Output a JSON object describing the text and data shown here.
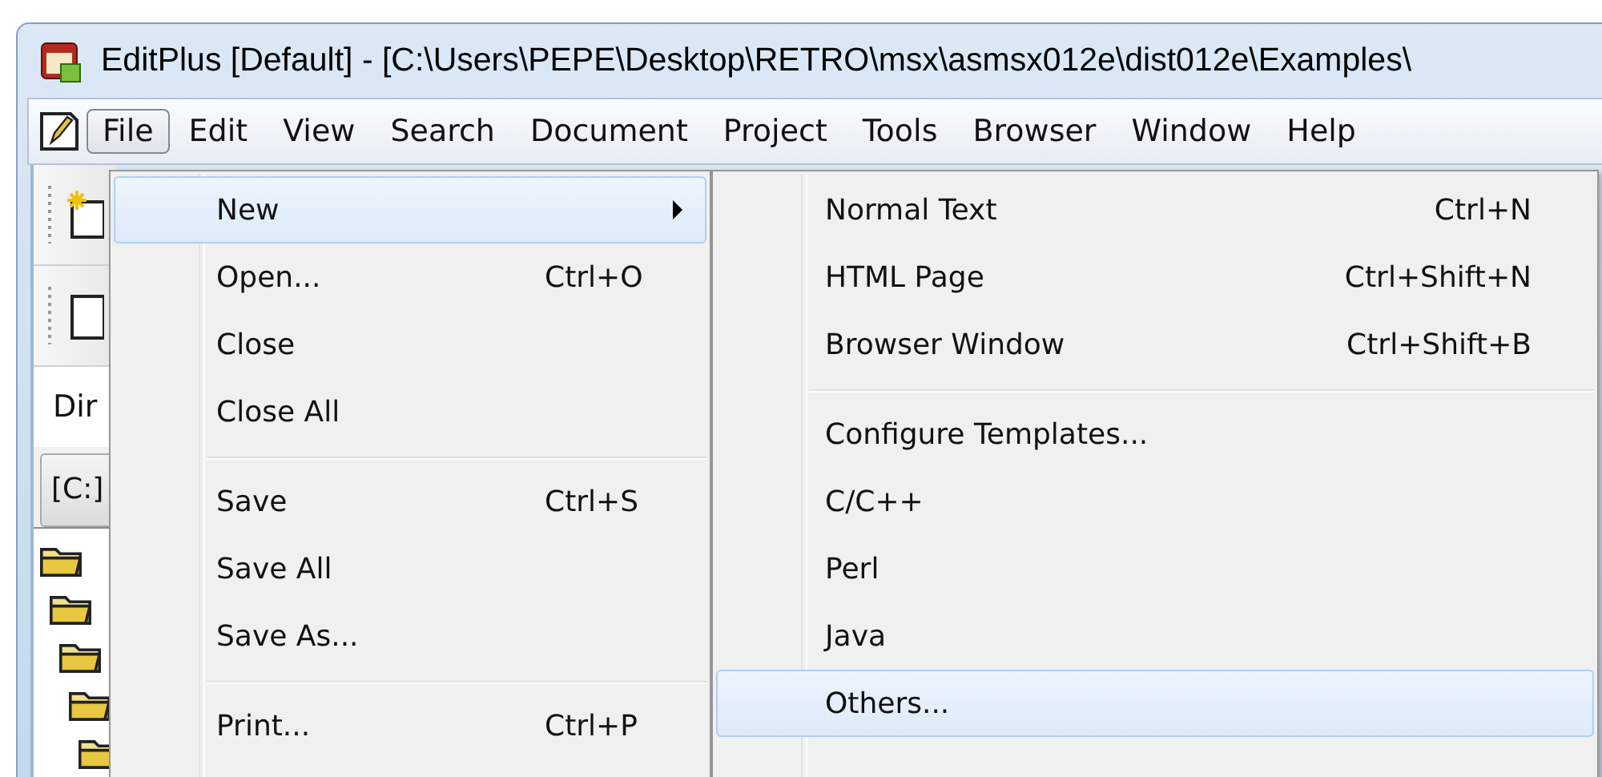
{
  "window": {
    "title": "EditPlus [Default] - [C:\\Users\\PEPE\\Desktop\\RETRO\\msx\\asmsx012e\\dist012e\\Examples\\"
  },
  "menu_bar": [
    {
      "label": "File",
      "selected": true
    },
    {
      "label": "Edit",
      "selected": false
    },
    {
      "label": "View",
      "selected": false
    },
    {
      "label": "Search",
      "selected": false
    },
    {
      "label": "Document",
      "selected": false
    },
    {
      "label": "Project",
      "selected": false
    },
    {
      "label": "Tools",
      "selected": false
    },
    {
      "label": "Browser",
      "selected": false
    },
    {
      "label": "Window",
      "selected": false
    },
    {
      "label": "Help",
      "selected": false
    }
  ],
  "side_panel": {
    "tab": "Dir",
    "drive": "[C:]"
  },
  "file_menu": [
    {
      "kind": "item",
      "label": "New",
      "has_submenu": true,
      "selected": true
    },
    {
      "kind": "item",
      "label": "Open...",
      "shortcut": "Ctrl+O",
      "has_submenu": false,
      "selected": false
    },
    {
      "kind": "item",
      "label": "Close",
      "has_submenu": false,
      "selected": false
    },
    {
      "kind": "item",
      "label": "Close All",
      "has_submenu": false,
      "selected": false
    },
    {
      "kind": "separator"
    },
    {
      "kind": "item",
      "label": "Save",
      "shortcut": "Ctrl+S",
      "has_submenu": false,
      "selected": false
    },
    {
      "kind": "item",
      "label": "Save All",
      "has_submenu": false,
      "selected": false
    },
    {
      "kind": "item",
      "label": "Save As...",
      "has_submenu": false,
      "selected": false
    },
    {
      "kind": "separator"
    },
    {
      "kind": "item",
      "label": "Print...",
      "shortcut": "Ctrl+P",
      "has_submenu": false,
      "selected": false
    }
  ],
  "new_submenu": [
    {
      "kind": "item",
      "label": "Normal Text",
      "shortcut": "Ctrl+N",
      "selected": false
    },
    {
      "kind": "item",
      "label": "HTML Page",
      "shortcut": "Ctrl+Shift+N",
      "selected": false
    },
    {
      "kind": "item",
      "label": "Browser Window",
      "shortcut": "Ctrl+Shift+B",
      "selected": false
    },
    {
      "kind": "separator"
    },
    {
      "kind": "item",
      "label": "Configure Templates...",
      "selected": false
    },
    {
      "kind": "item",
      "label": "C/C++",
      "selected": false
    },
    {
      "kind": "item",
      "label": "Perl",
      "selected": false
    },
    {
      "kind": "item",
      "label": "Java",
      "selected": false
    },
    {
      "kind": "item",
      "label": "Others...",
      "selected": true
    }
  ]
}
